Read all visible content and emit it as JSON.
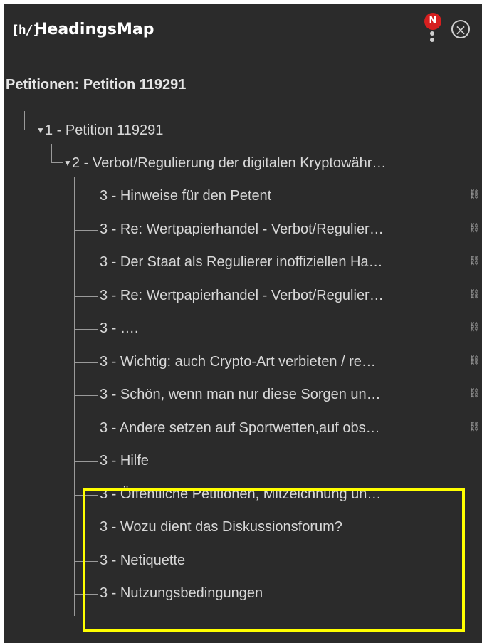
{
  "header": {
    "logo": "[h/]",
    "title": "HeadingsMap",
    "notification_badge": "N",
    "menu_icon": "vertical-dots-icon",
    "close_icon": "close-circle-icon",
    "close_glyph": "×"
  },
  "page_title": "Petitionen: Petition 119291",
  "tree": {
    "h1": {
      "label": "1 - Petition 119291",
      "expanded": true
    },
    "h2": {
      "label": "2 - Verbot/Regulierung der digitalen Kryptowähr…",
      "expanded": true
    },
    "h3_items": [
      {
        "label": "3 - Hinweise für den Petent",
        "has_link": true
      },
      {
        "label": "3 - Re: Wertpapierhandel - Verbot/Regulier…",
        "has_link": true
      },
      {
        "label": "3 - Der Staat als Regulierer inoffiziellen Ha…",
        "has_link": true
      },
      {
        "label": "3 - Re: Wertpapierhandel - Verbot/Regulier…",
        "has_link": true
      },
      {
        "label": "3 - ….",
        "has_link": true
      },
      {
        "label": "3 - Wichtig: auch Crypto-Art verbieten / re…",
        "has_link": true
      },
      {
        "label": "3 - Schön, wenn man nur diese Sorgen un…",
        "has_link": true
      },
      {
        "label": "3 - Andere setzen auf Sportwetten,auf obs…",
        "has_link": true
      },
      {
        "label": "3 - Hilfe",
        "has_link": false
      },
      {
        "label": "3 -  Öffentliche Petitionen, Mitzeichnung un…",
        "has_link": false
      },
      {
        "label": "3 -  Wozu dient das Diskussionsforum?",
        "has_link": false
      },
      {
        "label": "3 -  Netiquette",
        "has_link": false
      },
      {
        "label": "3 -  Nutzungsbedingungen",
        "has_link": false
      }
    ]
  },
  "colors": {
    "panel_bg": "#2b2b2b",
    "highlight": "#ffff00",
    "badge": "#d61f1f"
  },
  "link_glyph": "🔗"
}
